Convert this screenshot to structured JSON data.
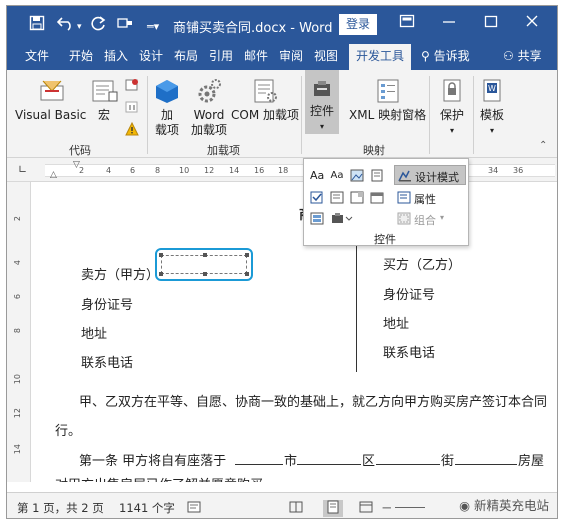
{
  "titlebar": {
    "save_icon": "save-icon",
    "undo_icon": "undo-icon",
    "redo_icon": "redo-icon",
    "title": "商铺买卖合同.docx - Word",
    "login_label": "登录",
    "ribbon_display_icon": "ribbon-display-options-icon",
    "minimize_icon": "minimize-icon",
    "restore_icon": "restore-icon",
    "close_icon": "close-icon"
  },
  "menu": {
    "tabs": [
      {
        "label": "文件"
      },
      {
        "label": "开始"
      },
      {
        "label": "插入"
      },
      {
        "label": "设计"
      },
      {
        "label": "布局"
      },
      {
        "label": "引用"
      },
      {
        "label": "邮件"
      },
      {
        "label": "审阅"
      },
      {
        "label": "视图"
      },
      {
        "label": "开发工具"
      }
    ],
    "tell_me": "告诉我",
    "share": "共享"
  },
  "ribbon": {
    "code": {
      "visual_basic": "Visual Basic",
      "macro": "宏",
      "group_label": "代码"
    },
    "addins": {
      "addins": "加\n载项",
      "word_addins": "Word\n加载项",
      "com_addins": "COM 加载项",
      "group_label": "加载项"
    },
    "controls": {
      "label": "控件"
    },
    "mapping": {
      "xml_pane": "XML 映射窗格",
      "group_label": "映射"
    },
    "protect": {
      "label": "保护"
    },
    "template": {
      "label": "模板"
    }
  },
  "ruler": {
    "numbers": [
      "2",
      "4",
      "6",
      "8",
      "10",
      "12",
      "14",
      "16",
      "18",
      "34",
      "36"
    ],
    "vertical_numbers": [
      "2",
      "4",
      "6",
      "8",
      "10",
      "12",
      "14"
    ]
  },
  "controls_dropdown": {
    "design_mode": "设计模式",
    "properties": "属性",
    "group": "组合",
    "group_label": "控件"
  },
  "document": {
    "heading_fragment": "商",
    "seller": "卖方（甲方）",
    "buyer": "买方（乙方）",
    "id_card_left": "身份证号",
    "id_card_right": "身份证号",
    "address_left": "地址",
    "address_right": "地址",
    "phone_left": "联系电话",
    "phone_right": "联系电话",
    "para1": "甲、乙双方在平等、自愿、协商一致的基础上，就乙方向甲方购买房产签订本合同",
    "para1_cont": "行。",
    "para2_a": "第一条 甲方将自有座落于",
    "para2_b": "市",
    "para2_c": "区",
    "para2_d": "街",
    "para2_e": "房屋",
    "para3": "对甲方出售房屋已作了解并愿意购买。"
  },
  "status": {
    "page": "第 1 页，共 2 页",
    "words": "1141 个字",
    "zoom_minus": "－",
    "watermark": "新精英充电站"
  }
}
